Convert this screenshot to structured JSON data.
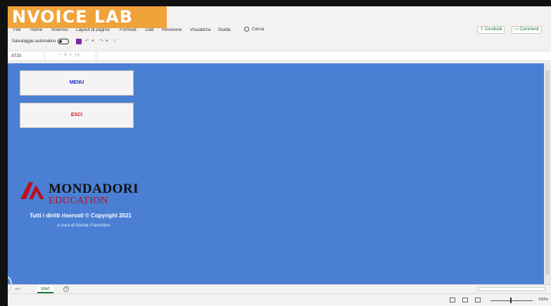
{
  "banner": {
    "text": "NVOICE LAB",
    "color": "#f0a33a"
  },
  "menu": {
    "items": [
      "File",
      "Home",
      "Inserisci",
      "Layout di pagina",
      "Formule",
      "Dati",
      "Revisione",
      "Visualizza",
      "Guida"
    ],
    "search_label": "Cerca",
    "share_label": "Condividi",
    "comments_label": "Commenti"
  },
  "qat": {
    "autosave_label": "Salvataggio automatico"
  },
  "formula_bar": {
    "name_box": "AT33",
    "formula": ""
  },
  "sheet": {
    "background": "#4a7fd4",
    "menu_button": "MENU",
    "exit_button": "ESCI",
    "logo_line1": "MONDADORI",
    "logo_line2": "EDUCATION",
    "copyright": "Tutti i diritti riservati © Copyright 2021",
    "curator": "a cura di Nicola Franchino"
  },
  "tabs": {
    "sheet_name": "start"
  },
  "status": {
    "zoom": "100%"
  }
}
